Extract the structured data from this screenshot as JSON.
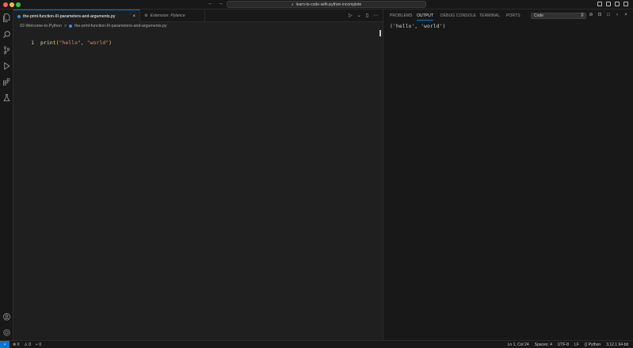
{
  "titlebar": {
    "command_center": "learn-to-code-with-python-incomplete",
    "back_glyph": "←",
    "forward_glyph": "→",
    "search_glyph": "⌕"
  },
  "tabs": [
    {
      "label": "the-print-function-III-parameters-and-arguments.py",
      "close": "×"
    },
    {
      "label": "Extension: Pylance"
    }
  ],
  "editor_actions": {
    "run": "▷",
    "run_menu": "⌄",
    "split": "▯",
    "more": "⋯"
  },
  "breadcrumb": {
    "folder": "02-Welcome-to-Python",
    "separator": ">",
    "file": "the-print-function-III-parameters-and-arguments.py"
  },
  "code": {
    "line_number": "1",
    "fn": "print",
    "open_paren": "(",
    "arg1": "\"hello\"",
    "sep": ", ",
    "arg2": "\"world\"",
    "close_paren": ")"
  },
  "panel": {
    "tabs": [
      "PROBLEMS",
      "OUTPUT",
      "DEBUG CONSOLE",
      "TERMINAL",
      "PORTS"
    ],
    "active_tab": "OUTPUT",
    "channel": "Code",
    "output": "('hello', 'world')"
  },
  "statusbar": {
    "remote": "⚡",
    "errors": "⊗ 0",
    "warnings": "⚠ 0",
    "ports": "⑂ 0",
    "position": "Ln 1, Col 24",
    "spaces": "Spaces: 4",
    "encoding": "UTF-8",
    "eol": "LF",
    "language": "{} Python",
    "interpreter": "3.12.1 64-bit"
  },
  "colors": {
    "accent": "#0078d4",
    "close": "#ff5f57",
    "minimize": "#febc2e",
    "maximize": "#28c840"
  }
}
